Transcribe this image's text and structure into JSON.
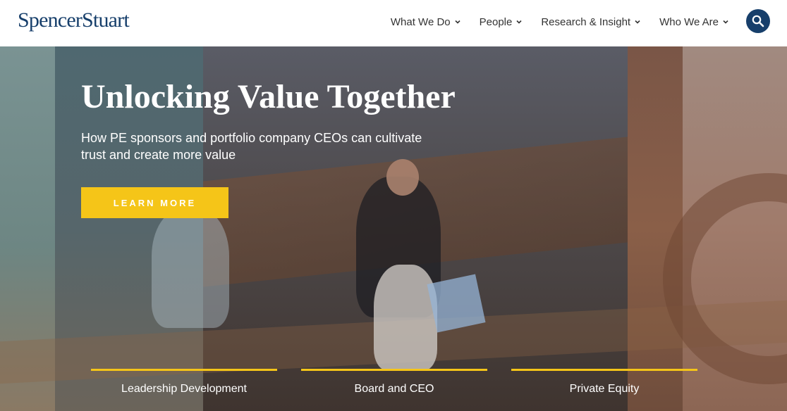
{
  "header": {
    "logo": "SpencerStuart",
    "nav": [
      {
        "label": "What We Do",
        "icon": "chevron-down-icon"
      },
      {
        "label": "People",
        "icon": "chevron-down-icon"
      },
      {
        "label": "Research & Insight",
        "icon": "chevron-down-icon"
      },
      {
        "label": "Who We Are",
        "icon": "chevron-down-icon"
      }
    ],
    "search_icon": "search-icon"
  },
  "hero": {
    "title": "Unlocking Value Together",
    "subtitle": "How PE sponsors and portfolio company CEOs can cultivate trust and create more value",
    "cta_label": "LEARN MORE",
    "links": [
      {
        "label": "Leadership Development"
      },
      {
        "label": "Board and CEO"
      },
      {
        "label": "Private Equity"
      }
    ]
  },
  "colors": {
    "brand_navy": "#173f6b",
    "accent_yellow": "#f5c518",
    "nav_text": "#333333"
  }
}
